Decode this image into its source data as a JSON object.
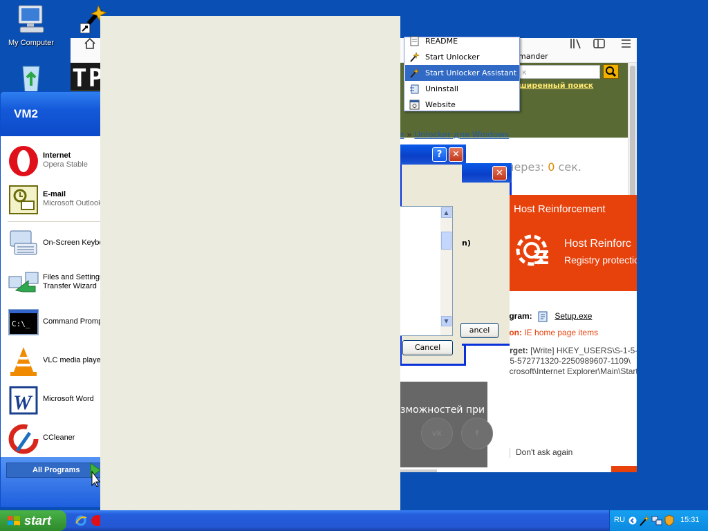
{
  "desktop": {
    "icons": [
      {
        "label": "My Computer",
        "icon": "my-computer-icon"
      },
      {
        "label": "",
        "icon": "recycle-bin-icon"
      },
      {
        "label": "",
        "icon": "unlocker-shortcut-icon"
      }
    ]
  },
  "browser": {
    "logo_partial": "TP",
    "search_placeholder": "к",
    "advanced_search": "ширенный поиск",
    "breadcrumb_sep": "»",
    "breadcrumb_prev": "e",
    "breadcrumb_current": "Unlocker для Windows",
    "countdown_prefix": "через: ",
    "countdown_value": "0",
    "countdown_suffix": " сек.",
    "banner_text": "зможностей при",
    "social": [
      "vk",
      "f"
    ],
    "menu_partial": "mander"
  },
  "unlocker_menu": {
    "items": [
      {
        "label": "README",
        "icon": "readme-icon",
        "selected": false
      },
      {
        "label": "Start Unlocker",
        "icon": "wand-icon",
        "selected": false
      },
      {
        "label": "Start Unlocker Assistant",
        "icon": "wand-icon",
        "selected": true
      },
      {
        "label": "Uninstall",
        "icon": "uninstall-icon",
        "selected": false
      },
      {
        "label": "Website",
        "icon": "website-icon",
        "selected": false
      }
    ]
  },
  "dialog_back": {
    "cancel_label": "Cancel",
    "help_label": "?",
    "close_label": "✕"
  },
  "dialog_front": {
    "partial_text": "n)",
    "cancel_label": "ancel",
    "close_label": "✕"
  },
  "alert": {
    "header_title": "Host Reinforcement",
    "feature_title": "Host Reinforc",
    "feature_subtitle": "Registry protectio",
    "program_label": "ogram:",
    "program_value": "Setup.exe",
    "action_label": "tion:",
    "action_value": "IE home page items",
    "target_label": "Target:",
    "target_line1": " [Write] HKEY_USERS\\S-1-5-",
    "target_line2": "415-572771320-2250989607-1109\\",
    "target_line3": "Microsoft\\Internet Explorer\\Main\\Start",
    "dont_ask": "Don't ask again"
  },
  "start_menu": {
    "user": "VM2",
    "pinned": [
      {
        "title": "Internet",
        "subtitle": "Opera Stable",
        "icon": "opera-icon"
      },
      {
        "title": "E-mail",
        "subtitle": "Microsoft Outlook",
        "icon": "outlook-icon"
      }
    ],
    "recent": [
      {
        "line1": "On-Screen Keyboard",
        "line2": "",
        "icon": "keyboard-icon"
      },
      {
        "line1": "Files and Settings",
        "line2": "Transfer Wizard",
        "icon": "transfer-wizard-icon"
      },
      {
        "line1": "Command Prompt",
        "line2": "",
        "icon": "command-prompt-icon"
      },
      {
        "line1": "VLC media player",
        "line2": "",
        "icon": "vlc-icon"
      },
      {
        "line1": "Microsoft Word",
        "line2": "",
        "icon": "word-icon"
      },
      {
        "line1": "CCleaner",
        "line2": "",
        "icon": "ccleaner-icon"
      }
    ],
    "all_programs": "All Programs"
  },
  "taskbar": {
    "start_label": "start",
    "language": "RU",
    "clock": "15:31"
  },
  "colors": {
    "desktop": "#0a4fb4",
    "selection": "#316ac5",
    "alert_accent": "#e8420c",
    "countdown": "#d98b00"
  }
}
